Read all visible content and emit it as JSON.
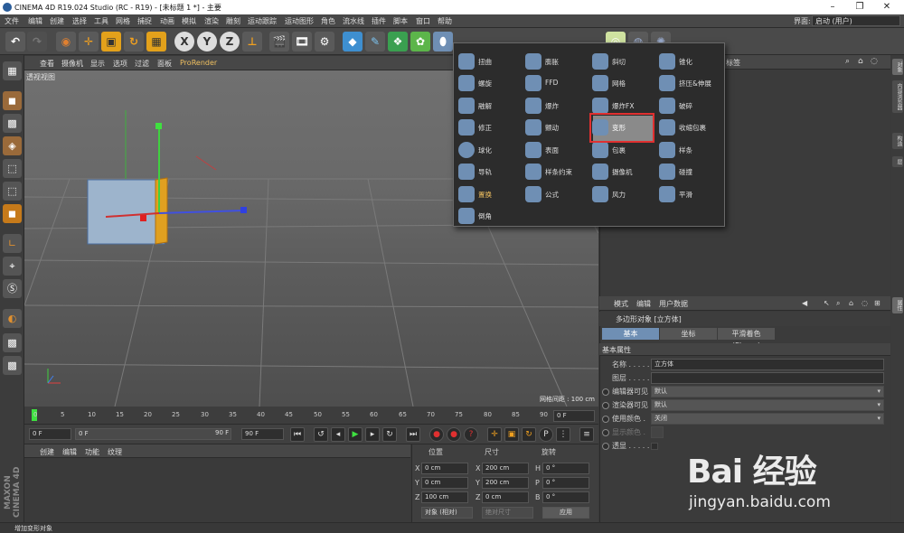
{
  "window": {
    "title": "CINEMA 4D R19.024 Studio (RC - R19) - [未标题 1 *] - 主要"
  },
  "menubar": [
    "文件",
    "编辑",
    "创建",
    "选择",
    "工具",
    "网格",
    "捕捉",
    "动画",
    "模拟",
    "渲染",
    "雕刻",
    "运动跟踪",
    "运动图形",
    "角色",
    "流水线",
    "插件",
    "脚本",
    "窗口",
    "帮助"
  ],
  "layout": {
    "label": "界面:",
    "value": "启动 (用户)"
  },
  "toolbar": {
    "axis_x": "X",
    "axis_y": "Y",
    "axis_z": "Z"
  },
  "viewport_menu": [
    "查看",
    "摄像机",
    "显示",
    "选项",
    "过滤",
    "面板",
    "ProRender"
  ],
  "viewport": {
    "label": "透视视图",
    "grid_spacing": "网格间距 : 100 cm"
  },
  "timeline": {
    "ticks": [
      "0",
      "5",
      "10",
      "15",
      "20",
      "25",
      "30",
      "35",
      "40",
      "45",
      "50",
      "55",
      "60",
      "65",
      "70",
      "75",
      "80",
      "85",
      "90"
    ],
    "end_frame": "0 F"
  },
  "transport": {
    "start": "0 F",
    "current": "0 F",
    "end_a": "90 F",
    "end_b": "90 F"
  },
  "material_menu": [
    "创建",
    "编辑",
    "功能",
    "纹理"
  ],
  "coords": {
    "headers": [
      "位置",
      "尺寸",
      "旋转"
    ],
    "rows": [
      {
        "a": "X",
        "pos": "0 cm",
        "b": "X",
        "size": "200 cm",
        "c": "H",
        "rot": "0 °"
      },
      {
        "a": "Y",
        "pos": "0 cm",
        "b": "Y",
        "size": "200 cm",
        "c": "P",
        "rot": "0 °"
      },
      {
        "a": "Z",
        "pos": "100 cm",
        "b": "Z",
        "size": "0 cm",
        "c": "B",
        "rot": "0 °"
      }
    ],
    "mode": "对象 (相对)",
    "size_mode": "绝对尺寸",
    "apply": "应用"
  },
  "object_panel": {
    "header": "标签"
  },
  "attributes": {
    "menu": [
      "模式",
      "编辑",
      "用户数据"
    ],
    "title": "多边形对象 [立方体]",
    "tabs": [
      "基本",
      "坐标",
      "平滑着色(Phong)"
    ],
    "section": "基本属性",
    "rows": [
      {
        "label": "名称 . . . . . . .",
        "value": "立方体"
      },
      {
        "label": "图层 . . . . . . .",
        "value": ""
      },
      {
        "label": "编辑器可见",
        "value": "默认"
      },
      {
        "label": "渲染器可见",
        "value": "默认"
      },
      {
        "label": "使用颜色 .",
        "value": "关闭"
      },
      {
        "label": "显示颜色 .",
        "value": ""
      },
      {
        "label": "透显 . . . . . .",
        "value": ""
      }
    ]
  },
  "side_tabs": [
    "对象",
    "内容浏览器",
    "构造",
    "层"
  ],
  "attr_side_tab": "属性",
  "popup": {
    "columns": [
      [
        "扭曲",
        "螺旋",
        "融解",
        "修正",
        "球化",
        "导轨",
        "置换",
        "倒角"
      ],
      [
        "膨胀",
        "FFD",
        "爆炸",
        "颤动",
        "表面",
        "样条约束",
        "公式"
      ],
      [
        "斜切",
        "网格",
        "爆炸FX",
        "变形",
        "包裹",
        "摄像机",
        "风力"
      ],
      [
        "锥化",
        "挤压&伸展",
        "破碎",
        "收缩包裹",
        "样条",
        "碰撞",
        "平滑"
      ]
    ],
    "highlighted": "变形"
  },
  "status": "增加变形对象",
  "maxon": "MAXON CINEMA 4D",
  "watermark": {
    "logo": "Bai 经验",
    "url": "jingyan.baidu.com"
  },
  "colors": {
    "accent": "#6f8fb4",
    "highlight_box": "#e03030",
    "cube": "#9db4cc"
  }
}
